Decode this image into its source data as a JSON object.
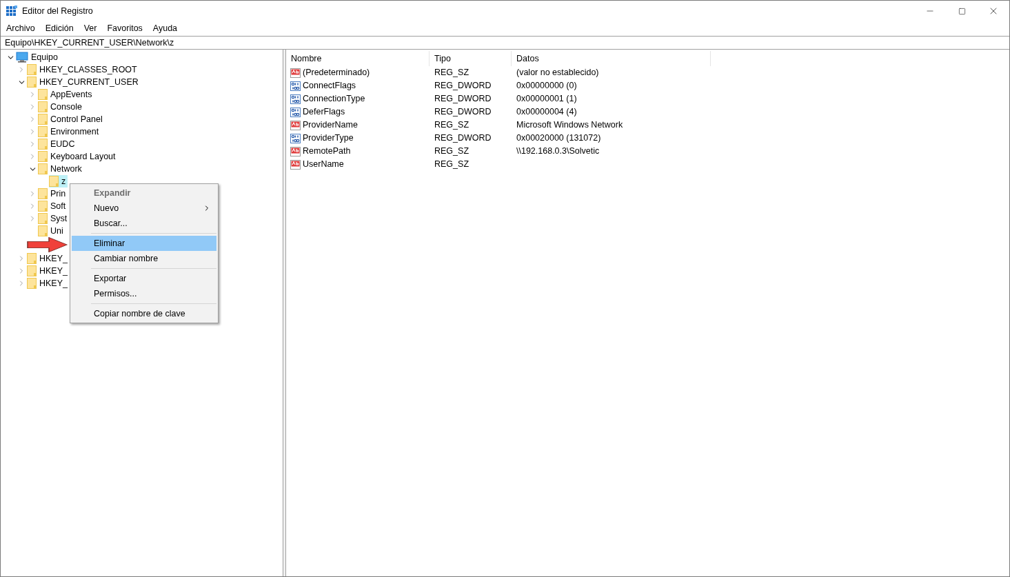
{
  "window": {
    "title": "Editor del Registro"
  },
  "menu": [
    "Archivo",
    "Edición",
    "Ver",
    "Favoritos",
    "Ayuda"
  ],
  "address": "Equipo\\HKEY_CURRENT_USER\\Network\\z",
  "tree": [
    {
      "label": "Equipo",
      "kind": "computer",
      "expandable": true,
      "expanded": true,
      "selected": false,
      "children": [
        {
          "label": "HKEY_CLASSES_ROOT",
          "kind": "folder",
          "expandable": true,
          "expanded": false,
          "selected": false
        },
        {
          "label": "HKEY_CURRENT_USER",
          "kind": "folder",
          "expandable": true,
          "expanded": true,
          "selected": false,
          "children": [
            {
              "label": "AppEvents",
              "kind": "folder",
              "expandable": true,
              "expanded": false,
              "selected": false
            },
            {
              "label": "Console",
              "kind": "folder",
              "expandable": true,
              "expanded": false,
              "selected": false
            },
            {
              "label": "Control Panel",
              "kind": "folder",
              "expandable": true,
              "expanded": false,
              "selected": false
            },
            {
              "label": "Environment",
              "kind": "folder",
              "expandable": true,
              "expanded": false,
              "selected": false
            },
            {
              "label": "EUDC",
              "kind": "folder",
              "expandable": true,
              "expanded": false,
              "selected": false
            },
            {
              "label": "Keyboard Layout",
              "kind": "folder",
              "expandable": true,
              "expanded": false,
              "selected": false
            },
            {
              "label": "Network",
              "kind": "folder",
              "expandable": true,
              "expanded": true,
              "selected": false,
              "children": [
                {
                  "label": "z",
                  "kind": "folder",
                  "expandable": false,
                  "selected": true
                }
              ]
            },
            {
              "label": "Prin",
              "kind": "folder",
              "expandable": true,
              "expanded": false,
              "selected": false
            },
            {
              "label": "Soft",
              "kind": "folder",
              "expandable": true,
              "expanded": false,
              "selected": false
            },
            {
              "label": "Syst",
              "kind": "folder",
              "expandable": true,
              "expanded": false,
              "selected": false
            },
            {
              "label": "Uni",
              "kind": "folder",
              "expandable": false,
              "selected": false
            },
            {
              "kind": "covered"
            }
          ]
        },
        {
          "label": "HKEY_",
          "kind": "folder",
          "expandable": true,
          "expanded": false,
          "selected": false
        },
        {
          "label": "HKEY_",
          "kind": "folder",
          "expandable": true,
          "expanded": false,
          "selected": false
        },
        {
          "label": "HKEY_",
          "kind": "folder",
          "expandable": true,
          "expanded": false,
          "selected": false
        }
      ]
    }
  ],
  "table": {
    "columns": [
      "Nombre",
      "Tipo",
      "Datos"
    ],
    "rows": [
      {
        "kind": "string",
        "name": "(Predeterminado)",
        "type": "REG_SZ",
        "data": "(valor no establecido)"
      },
      {
        "kind": "binary",
        "name": "ConnectFlags",
        "type": "REG_DWORD",
        "data": "0x00000000 (0)"
      },
      {
        "kind": "binary",
        "name": "ConnectionType",
        "type": "REG_DWORD",
        "data": "0x00000001 (1)"
      },
      {
        "kind": "binary",
        "name": "DeferFlags",
        "type": "REG_DWORD",
        "data": "0x00000004 (4)"
      },
      {
        "kind": "string",
        "name": "ProviderName",
        "type": "REG_SZ",
        "data": "Microsoft Windows Network"
      },
      {
        "kind": "binary",
        "name": "ProviderType",
        "type": "REG_DWORD",
        "data": "0x00020000 (131072)"
      },
      {
        "kind": "string",
        "name": "RemotePath",
        "type": "REG_SZ",
        "data": "\\\\192.168.0.3\\Solvetic"
      },
      {
        "kind": "string",
        "name": "UserName",
        "type": "REG_SZ"
      }
    ]
  },
  "context_menu": [
    {
      "kind": "item",
      "label": "Expandir",
      "disabled": true,
      "selected": false,
      "submenu": false
    },
    {
      "kind": "item",
      "label": "Nuevo",
      "disabled": false,
      "selected": false,
      "submenu": true
    },
    {
      "kind": "item",
      "label": "Buscar...",
      "disabled": false,
      "selected": false,
      "submenu": false
    },
    {
      "kind": "separator"
    },
    {
      "kind": "item",
      "label": "Eliminar",
      "disabled": false,
      "selected": true,
      "submenu": false
    },
    {
      "kind": "item",
      "label": "Cambiar nombre",
      "disabled": false,
      "selected": false,
      "submenu": false
    },
    {
      "kind": "separator"
    },
    {
      "kind": "item",
      "label": "Exportar",
      "disabled": false,
      "selected": false,
      "submenu": false
    },
    {
      "kind": "item",
      "label": "Permisos...",
      "disabled": false,
      "selected": false,
      "submenu": false
    },
    {
      "kind": "separator"
    },
    {
      "kind": "item",
      "label": "Copiar nombre de clave",
      "disabled": false,
      "selected": false,
      "submenu": false
    }
  ]
}
